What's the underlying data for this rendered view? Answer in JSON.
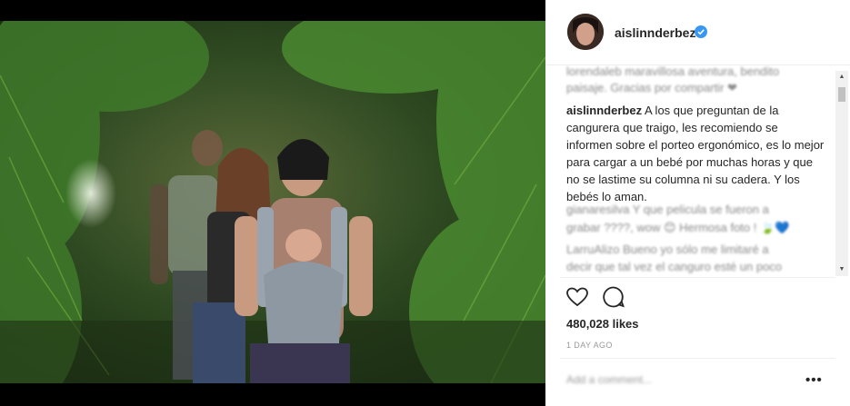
{
  "post": {
    "username": "aislinnderbez",
    "caption_user": "aislinnderbez",
    "caption_text": "A los que preguntan de la cangurera que traigo, les recomiendo se informen sobre el porteo ergonómico, es lo mejor para cargar a un bebé por muchas horas y que no se lastime su columna ni su cadera. Y los bebés lo aman.",
    "likes": "480,028 likes",
    "time": "1 DAY AGO",
    "more_label": "•••"
  },
  "blurred_comments": [
    "lorendaleb maravillosa aventura, bendito",
    "paisaje. Gracias por compartir ❤",
    "gianaresilva Y que pelicula se fueron a",
    "grabar ????, wow 😊 Hermosa foto ! 🍃💙",
    "LarruAlizo Bueno yo sólo me limitaré a",
    "decir que tal vez el canguro esté un poco"
  ],
  "add_comment_placeholder": "Add a comment...",
  "icons": {
    "verified": "verified-badge-icon",
    "like": "heart-icon",
    "comment": "comment-bubble-icon",
    "scroll_up": "scroll-up-arrow-icon",
    "scroll_down": "scroll-down-arrow-icon"
  },
  "colors": {
    "verified": "#3897f0",
    "text": "#262626",
    "muted": "#999999",
    "divider": "#efefef"
  }
}
